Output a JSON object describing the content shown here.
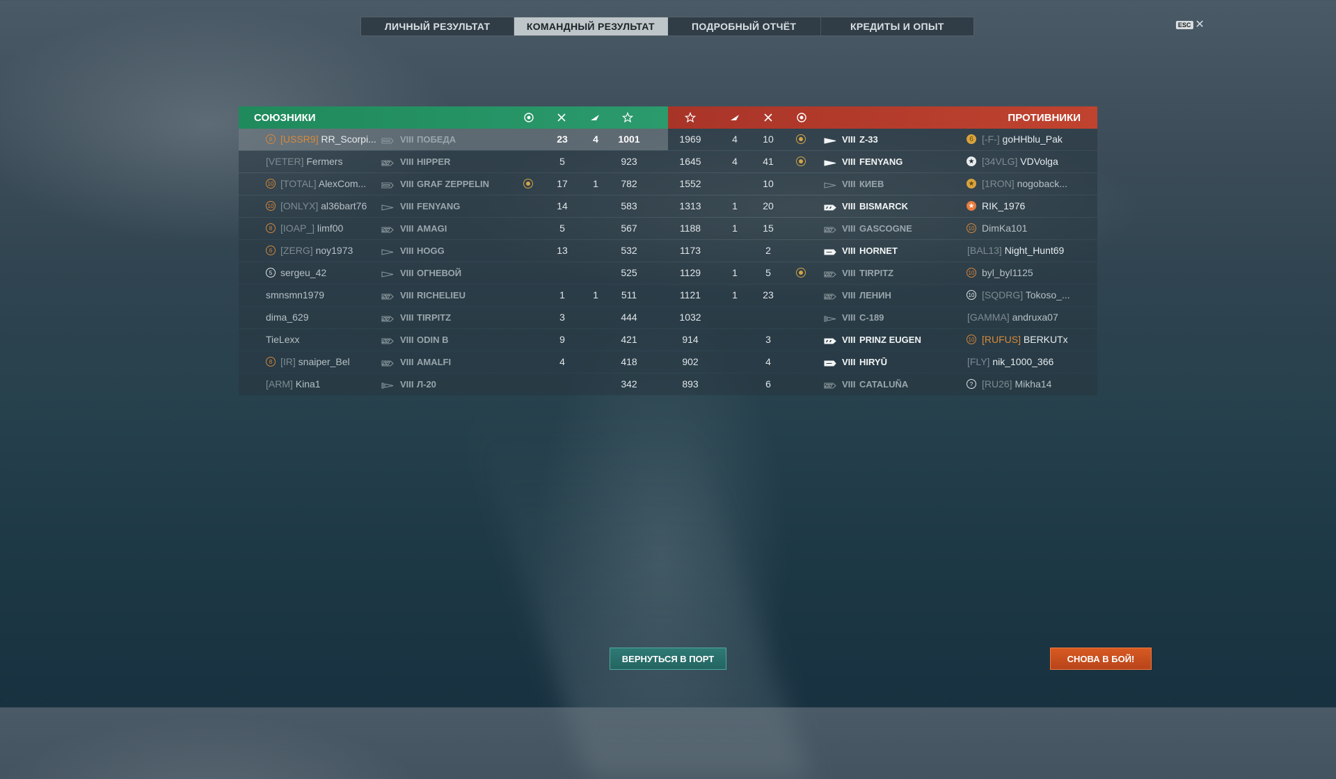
{
  "tabs": [
    {
      "label": "ЛИЧНЫЙ РЕЗУЛЬТАТ",
      "active": false
    },
    {
      "label": "КОМАНДНЫЙ РЕЗУЛЬТАТ",
      "active": true
    },
    {
      "label": "ПОДРОБНЫЙ ОТЧЁТ",
      "active": false
    },
    {
      "label": "КРЕДИТЫ И ОПЫТ",
      "active": false
    }
  ],
  "esc": {
    "key": "ESC",
    "close": "✕"
  },
  "allies": {
    "title": "СОЮЗНИКИ",
    "color": "#2b9a6c",
    "rows": [
      {
        "rank": "8",
        "rank_style": "orange",
        "clan": "[USSR9]",
        "name": "RR_Scorpi...",
        "ship_type": "carrier",
        "tier": "VIII",
        "ship": "ПОБЕДА",
        "medal": false,
        "kills": "23",
        "planes": "4",
        "xp": "1001",
        "highlight": true
      },
      {
        "rank": "",
        "rank_style": "",
        "clan": "[VETER]",
        "name": "Fermers",
        "ship_type": "battleship",
        "tier": "VIII",
        "ship": "HIPPER",
        "medal": false,
        "kills": "5",
        "planes": "",
        "xp": "923",
        "highlight": false
      },
      {
        "rank": "10",
        "rank_style": "orange",
        "clan": "[TOTAL]",
        "name": "AlexCom...",
        "ship_type": "carrier",
        "tier": "VIII",
        "ship": "GRAF ZEPPELIN",
        "medal": true,
        "kills": "17",
        "planes": "1",
        "xp": "782",
        "highlight": false
      },
      {
        "rank": "10",
        "rank_style": "orange",
        "clan": "[ONLYX]",
        "name": "al36bart76",
        "ship_type": "destroyer",
        "tier": "VIII",
        "ship": "FENYANG",
        "medal": false,
        "kills": "14",
        "planes": "",
        "xp": "583",
        "highlight": false
      },
      {
        "rank": "8",
        "rank_style": "orange",
        "clan": "[IOAP_]",
        "name": "limf00",
        "ship_type": "battleship",
        "tier": "VIII",
        "ship": "AMAGI",
        "medal": false,
        "kills": "5",
        "planes": "",
        "xp": "567",
        "highlight": false
      },
      {
        "rank": "6",
        "rank_style": "orange",
        "clan": "[ZERG]",
        "name": "noy1973",
        "ship_type": "destroyer",
        "tier": "VIII",
        "ship": "HOGG",
        "medal": false,
        "kills": "13",
        "planes": "",
        "xp": "532",
        "highlight": false
      },
      {
        "rank": "5",
        "rank_style": "white",
        "clan": "",
        "name": "sergeu_42",
        "ship_type": "destroyer",
        "tier": "VIII",
        "ship": "ОГНЕВОЙ",
        "medal": false,
        "kills": "",
        "planes": "",
        "xp": "525",
        "highlight": false
      },
      {
        "rank": "",
        "rank_style": "",
        "clan": "",
        "name": "smnsmn1979",
        "ship_type": "battleship",
        "tier": "VIII",
        "ship": "RICHELIEU",
        "medal": false,
        "kills": "1",
        "planes": "1",
        "xp": "511",
        "highlight": false
      },
      {
        "rank": "",
        "rank_style": "",
        "clan": "",
        "name": "dima_629",
        "ship_type": "battleship",
        "tier": "VIII",
        "ship": "TIRPITZ",
        "medal": false,
        "kills": "3",
        "planes": "",
        "xp": "444",
        "highlight": false
      },
      {
        "rank": "",
        "rank_style": "",
        "clan": "",
        "name": "TieLexx",
        "ship_type": "battleship",
        "tier": "VIII",
        "ship": "ODIN B",
        "medal": false,
        "kills": "9",
        "planes": "",
        "xp": "421",
        "highlight": false
      },
      {
        "rank": "8",
        "rank_style": "orange",
        "clan": "[IR]",
        "name": "snaiper_Bel",
        "ship_type": "battleship",
        "tier": "VIII",
        "ship": "AMALFI",
        "medal": false,
        "kills": "4",
        "planes": "",
        "xp": "418",
        "highlight": false
      },
      {
        "rank": "",
        "rank_style": "",
        "clan": "[ARM]",
        "name": "Kina1",
        "ship_type": "submarine",
        "tier": "VIII",
        "ship": "Л-20",
        "medal": false,
        "kills": "",
        "planes": "",
        "xp": "342",
        "highlight": false
      }
    ]
  },
  "enemies": {
    "title": "ПРОТИВНИКИ",
    "color": "#c0432f",
    "rows": [
      {
        "xp": "1969",
        "planes": "4",
        "kills": "10",
        "medal": true,
        "ship_type": "destroyer",
        "tier": "VIII",
        "ship": "Z-33",
        "alive": true,
        "rank": "6",
        "rank_style": "fill",
        "clan": "[-F-]",
        "name": "goHHblu_Pak",
        "clan_orange": false,
        "alive_name": true
      },
      {
        "xp": "1645",
        "planes": "4",
        "kills": "41",
        "medal": true,
        "ship_type": "destroyer",
        "tier": "VIII",
        "ship": "FENYANG",
        "alive": true,
        "rank": "★",
        "rank_style": "starwhite",
        "clan": "[34VLG]",
        "name": "VDVolga",
        "clan_orange": false,
        "alive_name": true
      },
      {
        "xp": "1552",
        "planes": "",
        "kills": "10",
        "medal": false,
        "ship_type": "destroyer",
        "tier": "VIII",
        "ship": "КИЕВ",
        "alive": false,
        "rank": "★",
        "rank_style": "fill",
        "clan": "[1RON]",
        "name": "nogoback...",
        "clan_orange": false,
        "alive_name": false
      },
      {
        "xp": "1313",
        "planes": "1",
        "kills": "20",
        "medal": false,
        "ship_type": "battleship",
        "tier": "VIII",
        "ship": "BISMARCK",
        "alive": true,
        "rank": "★",
        "rank_style": "star",
        "clan": "",
        "name": "RIK_1976",
        "clan_orange": false,
        "alive_name": true
      },
      {
        "xp": "1188",
        "planes": "1",
        "kills": "15",
        "medal": false,
        "ship_type": "battleship",
        "tier": "VIII",
        "ship": "GASCOGNE",
        "alive": false,
        "rank": "10",
        "rank_style": "orange",
        "clan": "",
        "name": "DimKa101",
        "clan_orange": false,
        "alive_name": false
      },
      {
        "xp": "1173",
        "planes": "",
        "kills": "2",
        "medal": false,
        "ship_type": "carrier",
        "tier": "VIII",
        "ship": "HORNET",
        "alive": true,
        "rank": "",
        "rank_style": "",
        "clan": "[BAL13]",
        "name": "Night_Hunt69",
        "clan_orange": false,
        "alive_name": true
      },
      {
        "xp": "1129",
        "planes": "1",
        "kills": "5",
        "medal": true,
        "ship_type": "battleship",
        "tier": "VIII",
        "ship": "TIRPITZ",
        "alive": false,
        "rank": "10",
        "rank_style": "orange",
        "clan": "",
        "name": "byl_byl1125",
        "clan_orange": false,
        "alive_name": false
      },
      {
        "xp": "1121",
        "planes": "1",
        "kills": "23",
        "medal": false,
        "ship_type": "battleship",
        "tier": "VIII",
        "ship": "ЛЕНИН",
        "alive": false,
        "rank": "10",
        "rank_style": "white",
        "clan": "[SQDRG]",
        "name": "Tokoso_...",
        "clan_orange": false,
        "alive_name": false
      },
      {
        "xp": "1032",
        "planes": "",
        "kills": "",
        "medal": false,
        "ship_type": "submarine",
        "tier": "VIII",
        "ship": "С-189",
        "alive": false,
        "rank": "",
        "rank_style": "",
        "clan": "[GAMMA]",
        "name": "andruxa07",
        "clan_orange": false,
        "alive_name": false
      },
      {
        "xp": "914",
        "planes": "",
        "kills": "3",
        "medal": false,
        "ship_type": "battleship",
        "tier": "VIII",
        "ship": "PRINZ EUGEN",
        "alive": true,
        "rank": "10",
        "rank_style": "orange",
        "clan": "[RUFUS]",
        "name": "BERKUTx",
        "clan_orange": true,
        "alive_name": true
      },
      {
        "xp": "902",
        "planes": "",
        "kills": "4",
        "medal": false,
        "ship_type": "carrier",
        "tier": "VIII",
        "ship": "HIRYŪ",
        "alive": true,
        "rank": "",
        "rank_style": "",
        "clan": "[FLY]",
        "name": "nik_1000_366",
        "clan_orange": false,
        "alive_name": true
      },
      {
        "xp": "893",
        "planes": "",
        "kills": "6",
        "medal": false,
        "ship_type": "battleship",
        "tier": "VIII",
        "ship": "CATALUÑA",
        "alive": false,
        "rank": "?",
        "rank_style": "white",
        "clan": "[RU26]",
        "name": "Mikha14",
        "clan_orange": false,
        "alive_name": false
      }
    ]
  },
  "columns_icons": {
    "medal": "medal-icon",
    "kills": "crossed-swords-icon",
    "planes": "plane-icon",
    "xp": "star-icon"
  },
  "buttons": {
    "port": "ВЕРНУТЬСЯ В ПОРТ",
    "battle": "СНОВА В БОЙ!"
  }
}
